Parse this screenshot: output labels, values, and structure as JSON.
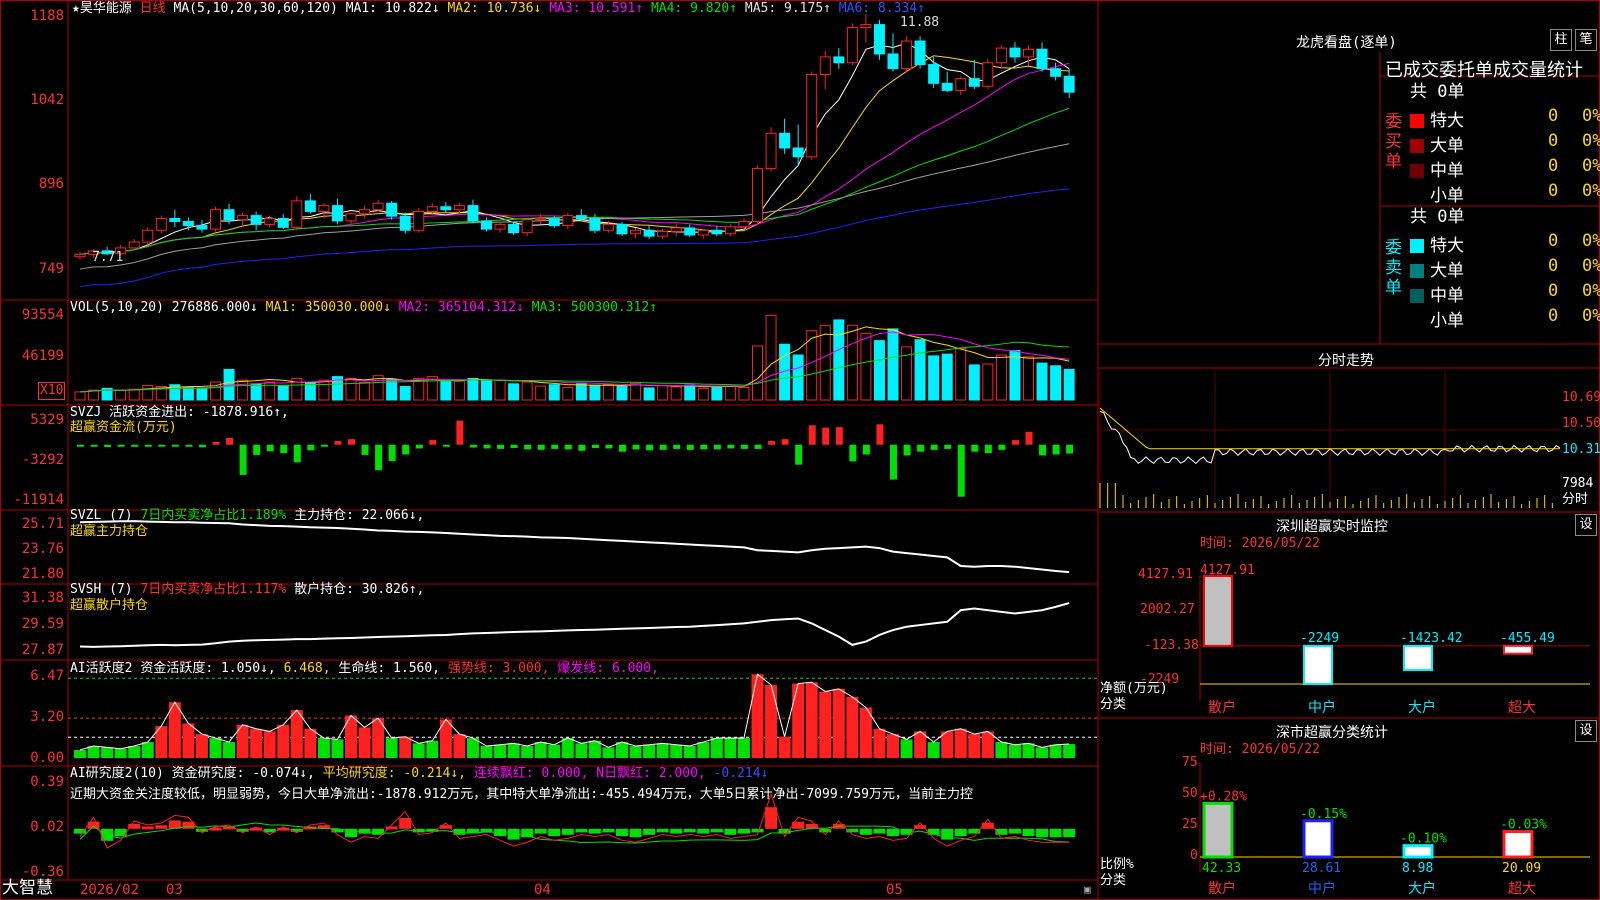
{
  "colors": {
    "up": "#ff2020",
    "down": "#00f0ff",
    "ma1": "#ffffff",
    "ma2": "#ffd800",
    "ma3": "#ff00ff",
    "ma4": "#00e000",
    "ma5": "#a0a0a0",
    "ma6": "#2020ff",
    "green": "#00e000"
  },
  "header": {
    "stock": "★昊华能源",
    "period": "日线",
    "ma_label": "MA(5,10,20,30,60,120)",
    "ma_values": [
      "MA1: 10.822↓",
      "MA2: 10.736↓",
      "MA3: 10.591↑",
      "MA4: 9.820↑",
      "MA5: 9.175↑",
      "MA6: 8.334↑"
    ]
  },
  "price_axis": [
    "1188",
    "1042",
    "896",
    "749"
  ],
  "price_annotations": {
    "high": "11.88",
    "low": "7.71"
  },
  "vol": {
    "title": "VOL(5,10,20)",
    "value": "276886.000↓",
    "ma": [
      "MA1: 350030.000↓",
      "MA2: 365104.312↓",
      "MA3: 500300.312↑"
    ],
    "axis": [
      "93554",
      "46199",
      "X10"
    ]
  },
  "svzj": {
    "title": "SVZJ",
    "label": "活跃资金进出: -1878.916↑,",
    "sub": "超赢资金流(万元)",
    "axis": [
      "5329",
      "-3292",
      "-11914"
    ]
  },
  "svzl": {
    "title": "SVZL (7)",
    "a": "7日内买卖净占比1.189%",
    "b": "主力持仓: 22.066↓,",
    "sub": "超赢主力持仓",
    "axis": [
      "25.71",
      "23.76",
      "21.80"
    ]
  },
  "svsh": {
    "title": "SVSH (7)",
    "a": "7日内买卖净占比1.117%",
    "b": "散户持仓: 30.826↑,",
    "sub": "超赢散户持仓",
    "axis": [
      "31.38",
      "29.59",
      "27.87"
    ]
  },
  "ai_active": {
    "title": "AI活跃度2",
    "a": "资金活跃度: 1.050↓,",
    "b": "6.468,",
    "c": "生命线: 1.560,",
    "d": "强势线: 3.000,",
    "e": "爆发线: 6.000,",
    "axis": [
      "6.47",
      "3.20",
      "0.00"
    ]
  },
  "ai_research": {
    "title": "AI研究度2(10)",
    "a": "资金研究度: -0.074↓,",
    "b": "平均研究度: -0.214↓,",
    "c": "连续飘红: 0.000,",
    "d": "N日飘红: 2.000,",
    "e": "-0.214↓",
    "note": "近期大资金关注度较低，明显弱势，今日大单净流出:-1878.912万元，其中特大单净流出:-455.494万元，大单5日累计净出-7099.759万元，当前主力控",
    "axis": [
      "0.39",
      "0.02",
      "-0.36"
    ]
  },
  "date_axis": [
    "2026/02",
    "03",
    "04",
    "05"
  ],
  "footer": {
    "brand": "大智慧"
  },
  "dragon": {
    "title": "龙虎看盘(逐单)",
    "btn1": "柱",
    "btn2": "笔",
    "subtitle": "已成交委托单成交量统计",
    "buy": {
      "label": "委买单",
      "total": "共 0单",
      "rows": [
        {
          "name": "特大",
          "count": "0",
          "pct": "0%",
          "color": "#ff0000"
        },
        {
          "name": "大单",
          "count": "0",
          "pct": "0%",
          "color": "#a00000"
        },
        {
          "name": "中单",
          "count": "0",
          "pct": "0%",
          "color": "#700000"
        },
        {
          "name": "小单",
          "count": "0",
          "pct": "0%",
          "color": ""
        }
      ]
    },
    "sell": {
      "label": "委卖单",
      "total": "共 0单",
      "rows": [
        {
          "name": "特大",
          "count": "0",
          "pct": "0%",
          "color": "#00f0ff"
        },
        {
          "name": "大单",
          "count": "0",
          "pct": "0%",
          "color": "#008080"
        },
        {
          "name": "中单",
          "count": "0",
          "pct": "0%",
          "color": "#006060"
        },
        {
          "name": "小单",
          "count": "0",
          "pct": "0%",
          "color": ""
        }
      ]
    }
  },
  "intraday": {
    "title": "分时走势",
    "axis": [
      "10.69",
      "10.50",
      "10.31",
      "7984"
    ],
    "unit": "分时"
  },
  "monitor": {
    "title": "深圳超赢实时监控",
    "btn": "设",
    "time": "时间: 2026/05/22",
    "axis": [
      "4127.91",
      "2002.27",
      "-123.38",
      "-2249"
    ],
    "ylabel": "净额(万元)",
    "xlabel": "分类"
  },
  "classify": {
    "title": "深市超赢分类统计",
    "btn": "设",
    "time": "时间: 2026/05/22",
    "axis": [
      "75",
      "50",
      "25",
      "0"
    ],
    "ylabel": "比例%",
    "xlabel": "分类"
  },
  "chart_data": [
    {
      "type": "candlestick",
      "title": "昊华能源 日线",
      "high": 11.88,
      "low": 7.71,
      "ylim": [
        7.49,
        11.88
      ],
      "ohlc": [
        [
          7.75,
          7.83,
          7.71,
          7.79
        ],
        [
          7.79,
          7.88,
          7.73,
          7.85
        ],
        [
          7.85,
          7.92,
          7.78,
          7.8
        ],
        [
          7.8,
          7.95,
          7.77,
          7.9
        ],
        [
          7.9,
          8.05,
          7.86,
          8.0
        ],
        [
          8.0,
          8.25,
          7.95,
          8.2
        ],
        [
          8.2,
          8.45,
          8.15,
          8.4
        ],
        [
          8.4,
          8.55,
          8.25,
          8.35
        ],
        [
          8.35,
          8.42,
          8.2,
          8.28
        ],
        [
          8.28,
          8.38,
          8.16,
          8.22
        ],
        [
          8.22,
          8.6,
          8.18,
          8.55
        ],
        [
          8.55,
          8.65,
          8.3,
          8.38
        ],
        [
          8.38,
          8.5,
          8.25,
          8.45
        ],
        [
          8.45,
          8.52,
          8.2,
          8.3
        ],
        [
          8.3,
          8.45,
          8.25,
          8.4
        ],
        [
          8.4,
          8.48,
          8.22,
          8.25
        ],
        [
          8.25,
          8.78,
          8.2,
          8.7
        ],
        [
          8.7,
          8.82,
          8.48,
          8.52
        ],
        [
          8.52,
          8.66,
          8.4,
          8.62
        ],
        [
          8.62,
          8.74,
          8.3,
          8.36
        ],
        [
          8.36,
          8.5,
          8.3,
          8.48
        ],
        [
          8.48,
          8.62,
          8.4,
          8.55
        ],
        [
          8.55,
          8.72,
          8.52,
          8.66
        ],
        [
          8.66,
          8.7,
          8.38,
          8.44
        ],
        [
          8.44,
          8.5,
          8.14,
          8.2
        ],
        [
          8.2,
          8.58,
          8.16,
          8.52
        ],
        [
          8.52,
          8.66,
          8.46,
          8.6
        ],
        [
          8.6,
          8.68,
          8.5,
          8.55
        ],
        [
          8.55,
          8.66,
          8.48,
          8.62
        ],
        [
          8.62,
          8.72,
          8.32,
          8.36
        ],
        [
          8.36,
          8.42,
          8.18,
          8.22
        ],
        [
          8.22,
          8.35,
          8.16,
          8.3
        ],
        [
          8.3,
          8.34,
          8.12,
          8.16
        ],
        [
          8.16,
          8.4,
          8.1,
          8.38
        ],
        [
          8.38,
          8.48,
          8.3,
          8.4
        ],
        [
          8.4,
          8.44,
          8.24,
          8.28
        ],
        [
          8.28,
          8.5,
          8.22,
          8.45
        ],
        [
          8.45,
          8.56,
          8.35,
          8.4
        ],
        [
          8.4,
          8.48,
          8.15,
          8.2
        ],
        [
          8.2,
          8.36,
          8.16,
          8.3
        ],
        [
          8.3,
          8.34,
          8.1,
          8.14
        ],
        [
          8.14,
          8.24,
          8.06,
          8.2
        ],
        [
          8.2,
          8.28,
          8.05,
          8.1
        ],
        [
          8.1,
          8.22,
          8.05,
          8.18
        ],
        [
          8.18,
          8.3,
          8.1,
          8.24
        ],
        [
          8.24,
          8.3,
          8.08,
          8.12
        ],
        [
          8.12,
          8.22,
          8.06,
          8.2
        ],
        [
          8.2,
          8.28,
          8.1,
          8.14
        ],
        [
          8.14,
          8.3,
          8.1,
          8.26
        ],
        [
          8.26,
          8.4,
          8.2,
          8.35
        ],
        [
          8.35,
          9.3,
          8.3,
          9.25
        ],
        [
          9.25,
          9.95,
          9.2,
          9.85
        ],
        [
          9.85,
          10.1,
          9.5,
          9.6
        ],
        [
          9.6,
          10.0,
          9.3,
          9.45
        ],
        [
          9.45,
          10.9,
          9.4,
          10.85
        ],
        [
          10.85,
          11.25,
          10.6,
          11.15
        ],
        [
          11.15,
          11.3,
          10.95,
          11.05
        ],
        [
          11.05,
          11.72,
          11.0,
          11.65
        ],
        [
          11.65,
          11.88,
          11.4,
          11.7
        ],
        [
          11.7,
          11.78,
          11.1,
          11.2
        ],
        [
          11.2,
          11.55,
          10.9,
          10.95
        ],
        [
          10.95,
          11.5,
          10.9,
          11.42
        ],
        [
          11.42,
          11.5,
          10.95,
          11.02
        ],
        [
          11.02,
          11.15,
          10.62,
          10.7
        ],
        [
          10.7,
          10.9,
          10.55,
          10.58
        ],
        [
          10.58,
          10.82,
          10.5,
          10.78
        ],
        [
          10.78,
          11.1,
          10.6,
          10.65
        ],
        [
          10.65,
          11.12,
          10.6,
          11.05
        ],
        [
          11.05,
          11.35,
          10.95,
          11.3
        ],
        [
          11.3,
          11.4,
          11.05,
          11.15
        ],
        [
          11.15,
          11.35,
          11.0,
          11.28
        ],
        [
          11.28,
          11.4,
          10.9,
          10.95
        ],
        [
          10.95,
          11.05,
          10.75,
          10.82
        ],
        [
          10.82,
          10.95,
          10.45,
          10.55
        ]
      ]
    },
    {
      "type": "bar",
      "title": "VOL(5,10,20)",
      "unit": "X10",
      "ylim": [
        0,
        100000
      ],
      "values": [
        9000,
        11000,
        13000,
        10500,
        12000,
        16000,
        15000,
        17000,
        14000,
        13500,
        20000,
        34000,
        22000,
        18000,
        20000,
        15500,
        24000,
        20000,
        22000,
        26000,
        24000,
        19500,
        27000,
        23000,
        15000,
        24000,
        26000,
        20500,
        21000,
        24000,
        21500,
        22000,
        18000,
        20000,
        15500,
        17000,
        14000,
        18000,
        16500,
        17000,
        15000,
        18500,
        13500,
        16000,
        14500,
        16500,
        13000,
        15500,
        15500,
        14000,
        60000,
        94000,
        62000,
        50000,
        77000,
        83000,
        89000,
        83000,
        74000,
        66000,
        79000,
        59000,
        67000,
        49000,
        51000,
        57000,
        39000,
        40000,
        50000,
        55000,
        48000,
        41000,
        38000,
        34000
      ]
    },
    {
      "type": "bar",
      "title": "超赢资金流(万元)",
      "ylim": [
        -11914,
        5329
      ],
      "values": [
        -300,
        -400,
        -500,
        -350,
        -450,
        -300,
        -200,
        -350,
        -400,
        -550,
        600,
        1500,
        -6500,
        -2200,
        -1400,
        -1800,
        -3800,
        -1200,
        -400,
        800,
        1200,
        -2200,
        -5500,
        -3500,
        -2100,
        -800,
        1000,
        -400,
        5200,
        -600,
        -800,
        -900,
        -700,
        -1000,
        -1100,
        -900,
        -1000,
        -1300,
        -700,
        -800,
        -1500,
        -1000,
        -1200,
        -1100,
        -900,
        -1100,
        -1000,
        -1000,
        -800,
        -900,
        -900,
        800,
        1200,
        -4300,
        4200,
        3700,
        3800,
        -3600,
        -2100,
        4400,
        -7500,
        -2300,
        -1500,
        -1100,
        -900,
        -11200,
        -1500,
        -1800,
        -1100,
        1000,
        2800,
        -2300,
        -2100,
        -1900
      ]
    },
    {
      "type": "line",
      "title": "超赢主力持仓",
      "ylim": [
        21.8,
        25.71
      ],
      "values": [
        25.55,
        25.58,
        25.6,
        25.62,
        25.63,
        25.6,
        25.58,
        25.55,
        25.55,
        25.52,
        25.5,
        25.48,
        25.4,
        25.35,
        25.3,
        25.28,
        25.25,
        25.2,
        25.18,
        25.15,
        25.1,
        25.05,
        24.98,
        24.95,
        24.9,
        24.88,
        24.85,
        24.8,
        24.75,
        24.7,
        24.65,
        24.6,
        24.58,
        24.55,
        24.5,
        24.48,
        24.45,
        24.4,
        24.35,
        24.3,
        24.25,
        24.2,
        24.15,
        24.1,
        24.05,
        24.0,
        23.95,
        23.9,
        23.85,
        23.8,
        23.6,
        23.55,
        23.5,
        23.45,
        23.6,
        23.7,
        23.75,
        23.8,
        23.85,
        23.75,
        23.5,
        23.4,
        23.3,
        23.2,
        23.1,
        22.5,
        22.45,
        22.5,
        22.5,
        22.45,
        22.35,
        22.25,
        22.15,
        22.07
      ]
    },
    {
      "type": "line",
      "title": "超赢散户持仓",
      "ylim": [
        27.87,
        31.38
      ],
      "values": [
        28.2,
        28.18,
        28.2,
        28.22,
        28.25,
        28.28,
        28.3,
        28.28,
        28.3,
        28.32,
        28.4,
        28.5,
        28.55,
        28.58,
        28.6,
        28.62,
        28.65,
        28.65,
        28.68,
        28.7,
        28.72,
        28.75,
        28.78,
        28.8,
        28.82,
        28.85,
        28.88,
        28.9,
        28.95,
        29.0,
        29.02,
        29.05,
        29.08,
        29.1,
        29.12,
        29.15,
        29.18,
        29.2,
        29.22,
        29.25,
        29.28,
        29.3,
        29.32,
        29.35,
        29.38,
        29.4,
        29.45,
        29.5,
        29.55,
        29.6,
        29.7,
        29.8,
        29.85,
        29.9,
        29.6,
        29.2,
        28.8,
        28.3,
        28.5,
        28.9,
        29.2,
        29.4,
        29.5,
        29.6,
        29.7,
        30.4,
        30.5,
        30.4,
        30.3,
        30.2,
        30.3,
        30.4,
        30.6,
        30.83
      ]
    },
    {
      "type": "bar",
      "title": "AI活跃度2",
      "ylim": [
        0,
        6.47
      ],
      "values": [
        0.6,
        0.9,
        0.8,
        0.7,
        0.9,
        1.2,
        2.4,
        4.2,
        2.6,
        1.8,
        1.5,
        1.2,
        2.5,
        2.2,
        2.0,
        2.5,
        3.6,
        2.2,
        1.5,
        1.4,
        3.2,
        2.3,
        3.0,
        1.5,
        1.6,
        1.1,
        1.3,
        2.9,
        1.8,
        1.5,
        0.9,
        1.0,
        1.1,
        0.9,
        1.2,
        1.0,
        1.5,
        1.1,
        1.3,
        0.8,
        1.2,
        0.9,
        1.0,
        1.1,
        1.0,
        0.9,
        1.2,
        1.5,
        1.5,
        1.5,
        6.3,
        5.5,
        1.6,
        5.6,
        5.7,
        5.0,
        5.2,
        4.6,
        3.8,
        2.2,
        1.8,
        1.4,
        2.0,
        1.2,
        2.0,
        2.2,
        1.8,
        2.0,
        1.2,
        1.0,
        1.1,
        0.8,
        1.0,
        1.05
      ]
    },
    {
      "type": "bar",
      "title": "AI研究度2(10)",
      "ylim": [
        -0.36,
        0.39
      ],
      "values": [
        -0.04,
        0.06,
        -0.1,
        -0.06,
        0.04,
        0.02,
        0.03,
        0.07,
        0.06,
        -0.02,
        0.01,
        0.02,
        -0.02,
        0.01,
        -0.03,
        0.01,
        -0.02,
        0.02,
        0.03,
        -0.03,
        -0.07,
        -0.04,
        -0.05,
        0.02,
        0.09,
        -0.03,
        -0.02,
        0.03,
        -0.05,
        -0.04,
        -0.03,
        -0.06,
        -0.09,
        -0.07,
        -0.04,
        -0.06,
        -0.05,
        -0.03,
        -0.04,
        -0.03,
        -0.06,
        -0.07,
        -0.05,
        -0.03,
        -0.04,
        -0.03,
        -0.04,
        -0.03,
        -0.05,
        -0.04,
        -0.03,
        0.18,
        -0.04,
        0.06,
        0.04,
        -0.03,
        0.04,
        -0.03,
        -0.05,
        -0.04,
        -0.06,
        -0.05,
        0.03,
        -0.05,
        -0.09,
        -0.06,
        -0.04,
        0.05,
        -0.05,
        -0.04,
        -0.06,
        -0.07,
        -0.07,
        -0.07
      ]
    },
    {
      "type": "line",
      "title": "分时走势",
      "axis_labels": [
        "10.69",
        "10.50",
        "10.31"
      ],
      "volume_label": "7984"
    },
    {
      "type": "bar",
      "title": "深圳超赢实时监控",
      "ylabel": "净额(万元)",
      "xlabel": "分类",
      "categories": [
        "散户",
        "中户",
        "大户",
        "超大"
      ],
      "values": [
        4127.91,
        -2249,
        -1423.42,
        -455.49
      ],
      "ylim": [
        -2249,
        4127.91
      ]
    },
    {
      "type": "bar",
      "title": "深市超赢分类统计",
      "ylabel": "比例%",
      "xlabel": "分类",
      "categories": [
        "散户",
        "中户",
        "大户",
        "超大"
      ],
      "values": [
        42.33,
        28.61,
        8.98,
        20.09
      ],
      "changes": [
        "+0.28%",
        "-0.15%",
        "-0.10%",
        "-0.03%"
      ],
      "ylim": [
        0,
        75
      ]
    }
  ]
}
